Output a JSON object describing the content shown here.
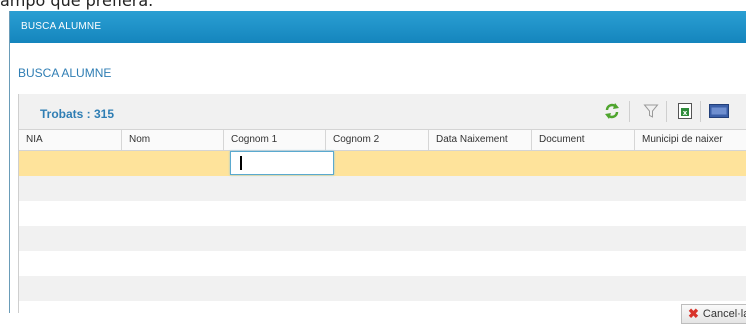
{
  "page": {
    "top_text": "ampo que prefiera."
  },
  "dialog": {
    "window_title": "BUSCA ALUMNE",
    "section_title": "BUSCA ALUMNE",
    "result_count": "Trobats : 315",
    "toolbar_icons": [
      "refresh-icon",
      "filter-icon",
      "excel-export-icon",
      "html-export-icon"
    ],
    "columns": [
      "NIA",
      "Nom",
      "Cognom 1",
      "Cognom 2",
      "Data Naixement",
      "Document",
      "Municipi de naixer"
    ],
    "edit_value": "",
    "cancel_label": "Cancel·lar",
    "colors": {
      "titlebar": "#1b8fc6",
      "accent_text": "#2f7eb4",
      "selected_row": "#fee39b",
      "cancel_icon": "#d8332a"
    }
  }
}
